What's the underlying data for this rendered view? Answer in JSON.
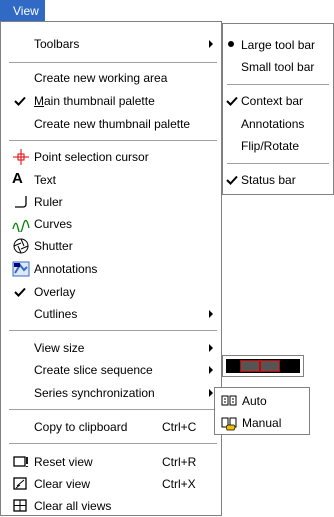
{
  "menubar": {
    "view_label": "View"
  },
  "main_menu": {
    "toolbars": "Toolbars",
    "create_new_working_area": "Create new working area",
    "main_thumbnail_palette": "Main thumbnail palette",
    "create_new_thumbnail_palette": "Create new thumbnail palette",
    "point_selection_cursor": "Point selection cursor",
    "text": "Text",
    "ruler": "Ruler",
    "curves": "Curves",
    "shutter": "Shutter",
    "annotations": "Annotations",
    "overlay": "Overlay",
    "cutlines": "Cutlines",
    "view_size": "View size",
    "create_slice_sequence": "Create slice sequence",
    "series_synchronization": "Series synchronization",
    "copy_to_clipboard": "Copy to clipboard",
    "copy_shortcut": "Ctrl+C",
    "reset_view": "Reset view",
    "reset_shortcut": "Ctrl+R",
    "clear_view": "Clear view",
    "clear_shortcut": "Ctrl+X",
    "clear_all_views": "Clear all views"
  },
  "toolbars_menu": {
    "large_tool_bar": "Large tool bar",
    "small_tool_bar": "Small tool bar",
    "context_bar": "Context bar",
    "annotations": "Annotations",
    "flip_rotate": "Flip/Rotate",
    "status_bar": "Status bar"
  },
  "sync_menu": {
    "auto": "Auto",
    "manual": "Manual"
  },
  "colors": {
    "highlight": "#316ac5",
    "separator": "#a0a0a0",
    "cursor_red": "#e00000",
    "slice_border": "#cc0000"
  }
}
